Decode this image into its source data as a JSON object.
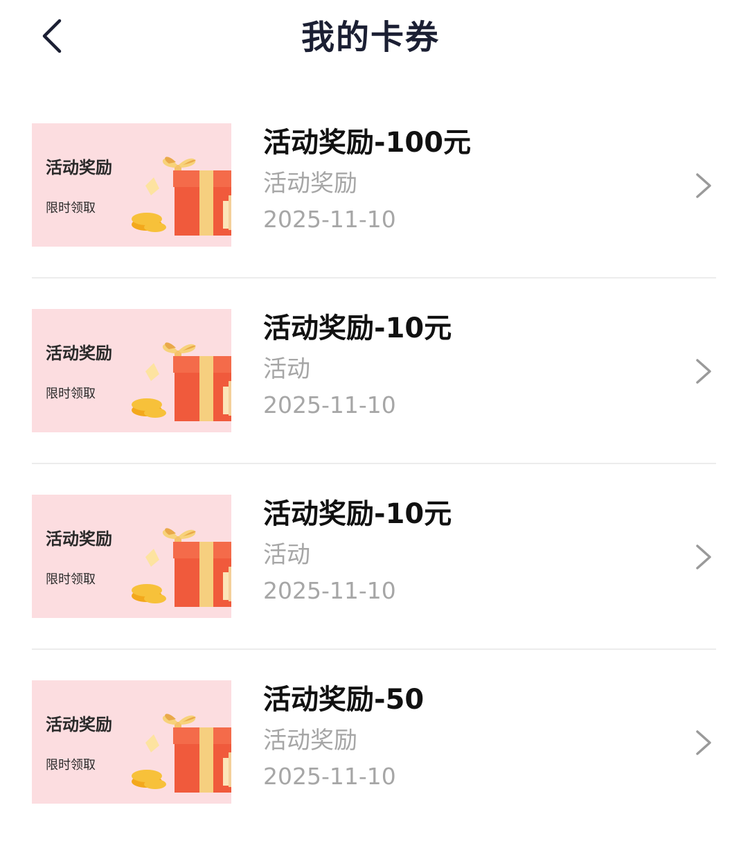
{
  "header": {
    "title": "我的卡券",
    "back_icon": "chevron-left-icon"
  },
  "coupons": [
    {
      "thumb_title": "活动奖励",
      "thumb_sub": "限时领取",
      "title": "活动奖励-100元",
      "type": "活动奖励",
      "date": "2025-11-10"
    },
    {
      "thumb_title": "活动奖励",
      "thumb_sub": "限时领取",
      "title": "活动奖励-10元",
      "type": "活动",
      "date": "2025-11-10"
    },
    {
      "thumb_title": "活动奖励",
      "thumb_sub": "限时领取",
      "title": "活动奖励-10元",
      "type": "活动",
      "date": "2025-11-10"
    },
    {
      "thumb_title": "活动奖励",
      "thumb_sub": "限时领取",
      "title": "活动奖励-50",
      "type": "活动奖励",
      "date": "2025-11-10"
    }
  ],
  "colors": {
    "thumb_bg": "#fcdde0",
    "title": "#1b1f33",
    "muted": "#a6a6a6",
    "gift_red": "#f05a3c",
    "gold": "#f7b733"
  }
}
